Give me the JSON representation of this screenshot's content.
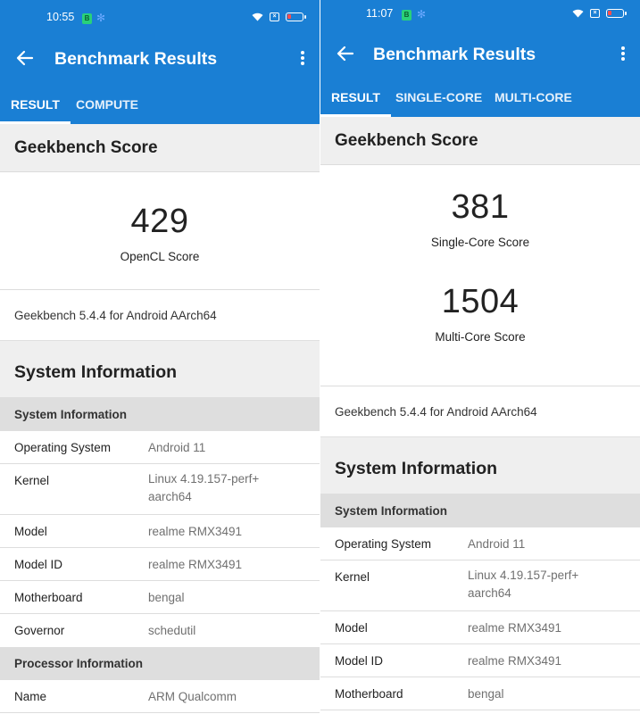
{
  "colors": {
    "appbar": "#1a7fd4",
    "section_bg": "#efefef",
    "subheader_bg": "#dedede"
  },
  "left": {
    "status": {
      "time": "10:55",
      "notif_icon": "notification-badge-icon",
      "gear_icon": "gear-icon"
    },
    "title": "Benchmark Results",
    "tabs": [
      "RESULT",
      "COMPUTE"
    ],
    "score_header": "Geekbench Score",
    "scores": [
      {
        "value": "429",
        "label": "OpenCL Score"
      }
    ],
    "version": "Geekbench 5.4.4 for Android AArch64",
    "sys_title": "System Information",
    "sys_subheader": "System Information",
    "rows": [
      {
        "key": "Operating System",
        "value": "Android 11"
      },
      {
        "key": "Kernel",
        "value": "Linux 4.19.157-perf+",
        "value2": "aarch64"
      },
      {
        "key": "Model",
        "value": "realme RMX3491"
      },
      {
        "key": "Model ID",
        "value": "realme RMX3491"
      },
      {
        "key": "Motherboard",
        "value": "bengal"
      },
      {
        "key": "Governor",
        "value": "schedutil"
      }
    ],
    "proc_subheader": "Processor Information",
    "proc_rows": [
      {
        "key": "Name",
        "value": "ARM Qualcomm"
      }
    ]
  },
  "right": {
    "status": {
      "time": "11:07",
      "notif_icon": "notification-badge-icon",
      "gear_icon": "gear-icon"
    },
    "title": "Benchmark Results",
    "tabs": [
      "RESULT",
      "SINGLE-CORE",
      "MULTI-CORE"
    ],
    "score_header": "Geekbench Score",
    "scores": [
      {
        "value": "381",
        "label": "Single-Core Score"
      },
      {
        "value": "1504",
        "label": "Multi-Core Score"
      }
    ],
    "version": "Geekbench 5.4.4 for Android AArch64",
    "sys_title": "System Information",
    "sys_subheader": "System Information",
    "rows": [
      {
        "key": "Operating System",
        "value": "Android 11"
      },
      {
        "key": "Kernel",
        "value": "Linux 4.19.157-perf+",
        "value2": "aarch64"
      },
      {
        "key": "Model",
        "value": "realme RMX3491"
      },
      {
        "key": "Model ID",
        "value": "realme RMX3491"
      },
      {
        "key": "Motherboard",
        "value": "bengal"
      }
    ]
  }
}
